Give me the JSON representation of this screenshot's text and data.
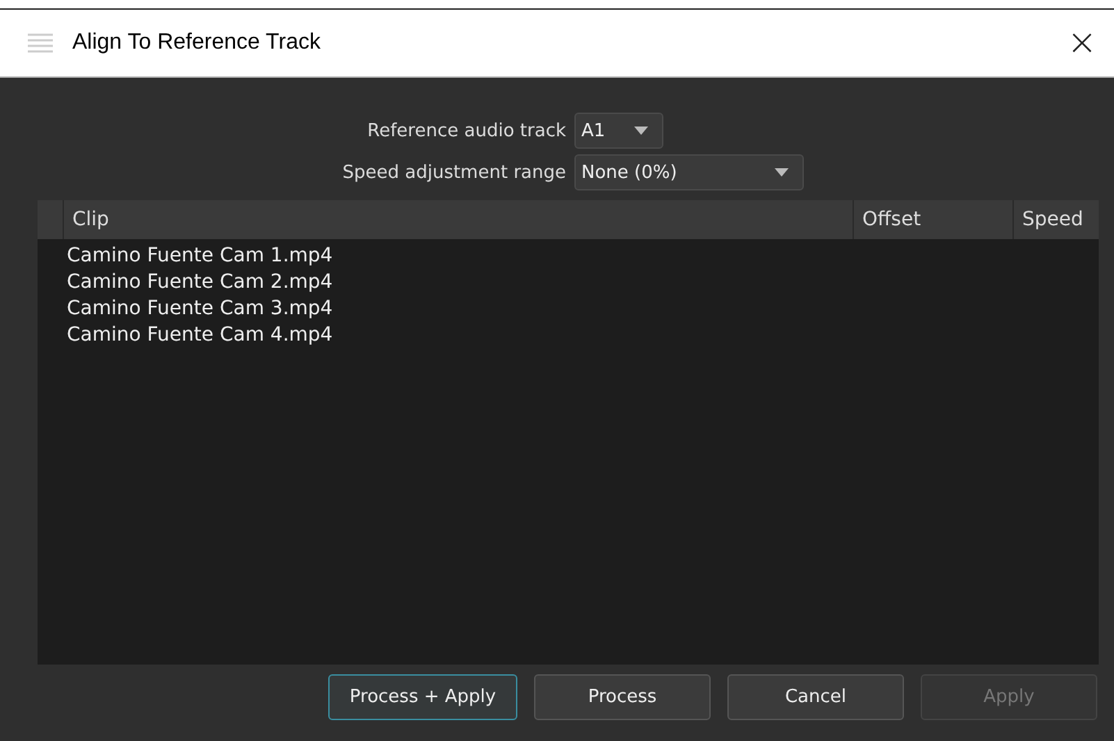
{
  "window": {
    "title": "Align To Reference Track",
    "close": "×"
  },
  "form": [
    {
      "label": "Reference audio track",
      "value": "A1"
    },
    {
      "label": "Speed adjustment range",
      "value": "None (0%)"
    }
  ],
  "table": {
    "columns": [
      "Clip",
      "Offset",
      "Speed"
    ],
    "rows": [
      [
        "Camino Fuente Cam 1.mp4"
      ],
      [
        "Camino Fuente Cam 2.mp4"
      ],
      [
        "Camino Fuente Cam 3.mp4"
      ],
      [
        "Camino Fuente Cam 4.mp4"
      ]
    ]
  },
  "buttons": [
    {
      "label": "Process + Apply",
      "focused": true,
      "disabled": false
    },
    {
      "label": "Process",
      "focused": false,
      "disabled": false
    },
    {
      "label": "Cancel",
      "focused": false,
      "disabled": false
    },
    {
      "label": "Apply",
      "focused": false,
      "disabled": true
    }
  ]
}
